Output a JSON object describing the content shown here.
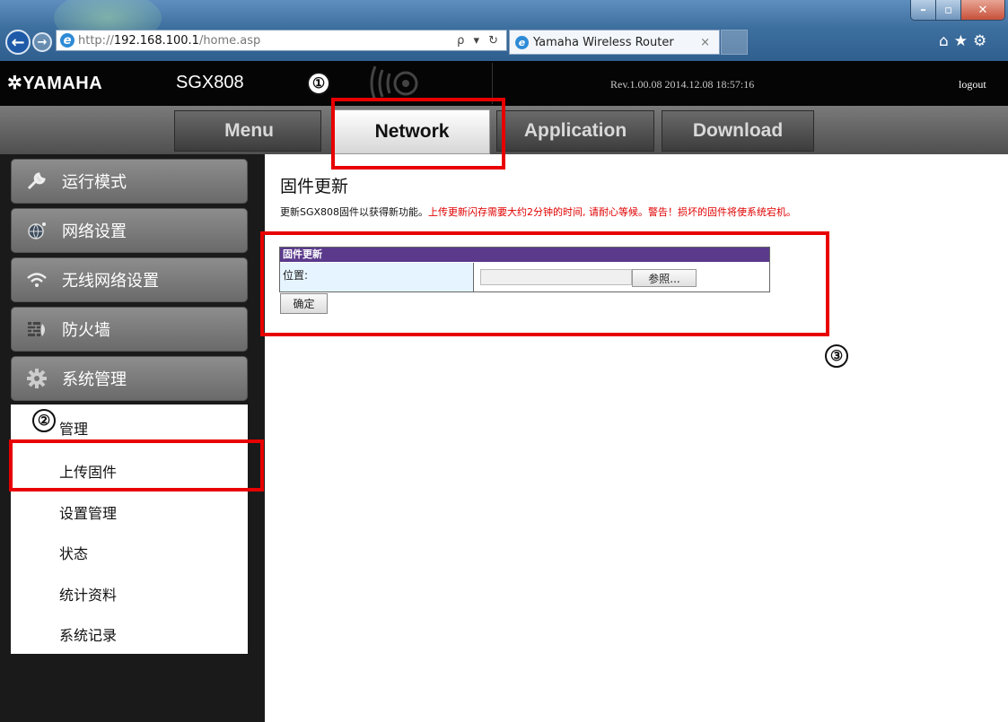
{
  "browser": {
    "url_proto": "http://",
    "url_host": "192.168.100.1",
    "url_path": "/home.asp",
    "address_tools": "ρ ▾ ↻",
    "tab_title": "Yamaha Wireless Router",
    "tab_close": "×"
  },
  "router": {
    "brand": "✲YAMAHA",
    "model": "SGX808",
    "revision": "Rev.1.00.08   2014.12.08 18:57:16",
    "logout": "logout"
  },
  "main_tabs": [
    {
      "label": "Menu"
    },
    {
      "label": "Network",
      "active": true
    },
    {
      "label": "Application"
    },
    {
      "label": "Download"
    }
  ],
  "sidebar": {
    "items": [
      {
        "label": "运行模式",
        "icon": "wrench-icon"
      },
      {
        "label": "网络设置",
        "icon": "globe-icon"
      },
      {
        "label": "无线网络设置",
        "icon": "wifi-icon"
      },
      {
        "label": "防火墙",
        "icon": "firewall-icon"
      },
      {
        "label": "系统管理",
        "icon": "gear-icon"
      }
    ],
    "submenu": [
      {
        "label": "管理"
      },
      {
        "label": "上传固件",
        "highlighted": true
      },
      {
        "label": "设置管理"
      },
      {
        "label": "状态"
      },
      {
        "label": "统计资料"
      },
      {
        "label": "系统记录"
      }
    ]
  },
  "content": {
    "title": "固件更新",
    "desc_normal": "更新SGX808固件以获得新功能。",
    "desc_warning": "上传更新闪存需要大约2分钟的时间, 请耐心等候。警告！损坏的固件将使系统宕机。",
    "table_header": "固件更新",
    "location_label": "位置:",
    "browse_label": "参照...",
    "ok_label": "确定"
  },
  "annotations": {
    "marker_1": "①",
    "marker_2": "②",
    "marker_3": "③",
    "annotation_color": "#e80000"
  },
  "colors": {
    "table_header_bg": "#5b3a8c",
    "location_cell_bg": "#e6f4ff",
    "warning_text": "#e00000"
  }
}
